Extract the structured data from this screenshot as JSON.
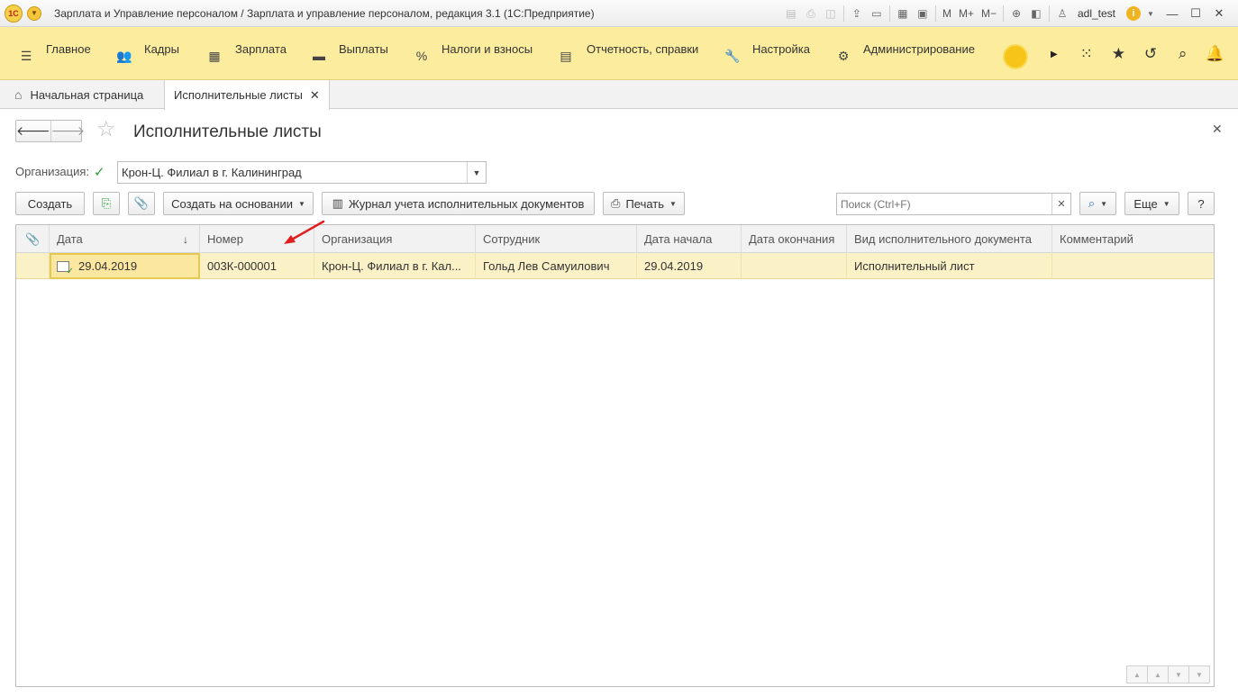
{
  "titlebar": {
    "logo": "1С",
    "title": "Зарплата и Управление персоналом / Зарплата и управление персоналом, редакция 3.1  (1С:Предприятие)",
    "m_label": "M",
    "m_plus": "M+",
    "m_minus": "M−",
    "user": "adl_test",
    "info": "i"
  },
  "sections": [
    {
      "label": "Главное",
      "icon": "menu-icon"
    },
    {
      "label": "Кадры",
      "icon": "people-icon"
    },
    {
      "label": "Зарплата",
      "icon": "calculator-icon"
    },
    {
      "label": "Выплаты",
      "icon": "wallet-icon"
    },
    {
      "label": "Налоги и взносы",
      "icon": "percent-icon"
    },
    {
      "label": "Отчетность, справки",
      "icon": "report-icon"
    },
    {
      "label": "Настройка",
      "icon": "wrench-icon"
    },
    {
      "label": "Администрирование",
      "icon": "gear-icon"
    }
  ],
  "tabs": {
    "home": "Начальная страница",
    "active": "Исполнительные листы"
  },
  "form": {
    "title": "Исполнительные листы",
    "org_label": "Организация:",
    "org_value": "Крон-Ц. Филиал в г. Калининград"
  },
  "toolbar": {
    "create": "Создать",
    "create_based": "Создать на основании",
    "journal": "Журнал учета исполнительных документов",
    "print": "Печать",
    "search_placeholder": "Поиск (Ctrl+F)",
    "more": "Еще",
    "help": "?"
  },
  "table": {
    "columns": [
      "Дата",
      "Номер",
      "Организация",
      "Сотрудник",
      "Дата начала",
      "Дата окончания",
      "Вид исполнительного документа",
      "Комментарий"
    ],
    "rows": [
      {
        "date": "29.04.2019",
        "number": "003К-000001",
        "org": "Крон-Ц. Филиал в г. Кал...",
        "employee": "Гольд Лев Самуилович",
        "start": "29.04.2019",
        "end": "",
        "doc_type": "Исполнительный лист",
        "comment": ""
      }
    ]
  },
  "colors": {
    "section_bar": "#fbec9e",
    "row_highlight": "#fbf1c6",
    "annotation_arrow": "#e02020"
  }
}
